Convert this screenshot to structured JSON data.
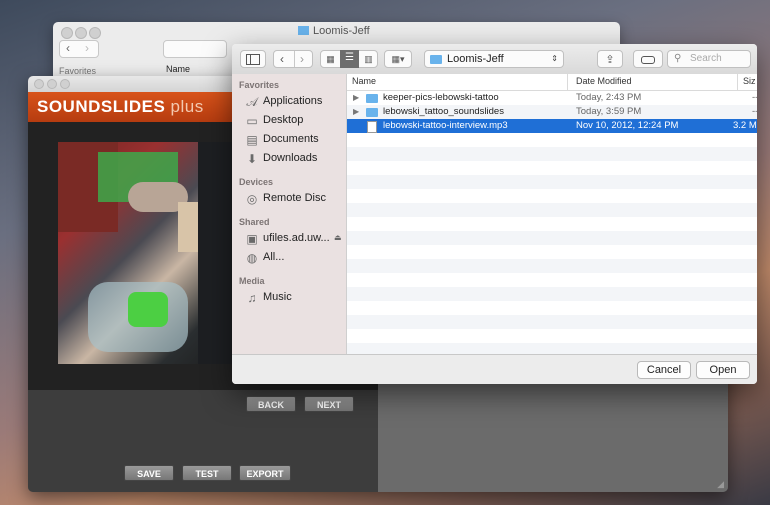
{
  "finder_back": {
    "title": "Loomis-Jeff",
    "sidebar_header": "Favorites",
    "column_name": "Name"
  },
  "soundslides": {
    "logo": "SOUNDSLIDES",
    "logo_suffix": "plus",
    "buttons": {
      "back": "BACK",
      "next": "NEXT",
      "save": "SAVE",
      "test": "TEST",
      "export": "EXPORT"
    }
  },
  "dialog": {
    "location": "Loomis-Jeff",
    "search_placeholder": "Search",
    "sidebar": {
      "favorites_header": "Favorites",
      "favorites": [
        {
          "label": "Applications",
          "icon": "applications-icon"
        },
        {
          "label": "Desktop",
          "icon": "desktop-icon"
        },
        {
          "label": "Documents",
          "icon": "documents-icon"
        },
        {
          "label": "Downloads",
          "icon": "downloads-icon"
        }
      ],
      "devices_header": "Devices",
      "devices": [
        {
          "label": "Remote Disc",
          "icon": "disc-icon"
        }
      ],
      "shared_header": "Shared",
      "shared": [
        {
          "label": "ufiles.ad.uw...",
          "icon": "server-icon"
        },
        {
          "label": "All...",
          "icon": "network-icon"
        }
      ],
      "media_header": "Media",
      "media": [
        {
          "label": "Music",
          "icon": "music-icon"
        }
      ]
    },
    "columns": {
      "name": "Name",
      "date_modified": "Date Modified",
      "size": "Siz"
    },
    "files": [
      {
        "name": "keeper-pics-lebowski-tattoo",
        "date": "Today, 2:43 PM",
        "size": "--",
        "kind": "folder"
      },
      {
        "name": "lebowski_tattoo_soundslides",
        "date": "Today, 3:59 PM",
        "size": "--",
        "kind": "folder"
      },
      {
        "name": "lebowski-tattoo-interview.mp3",
        "date": "Nov 10, 2012, 12:24 PM",
        "size": "3.2 M",
        "kind": "file",
        "selected": true
      }
    ],
    "cancel_label": "Cancel",
    "open_label": "Open"
  },
  "colors": {
    "selection": "#1f6fd6",
    "brand_orange": "#d8531a",
    "folder_blue": "#69b3ec"
  }
}
